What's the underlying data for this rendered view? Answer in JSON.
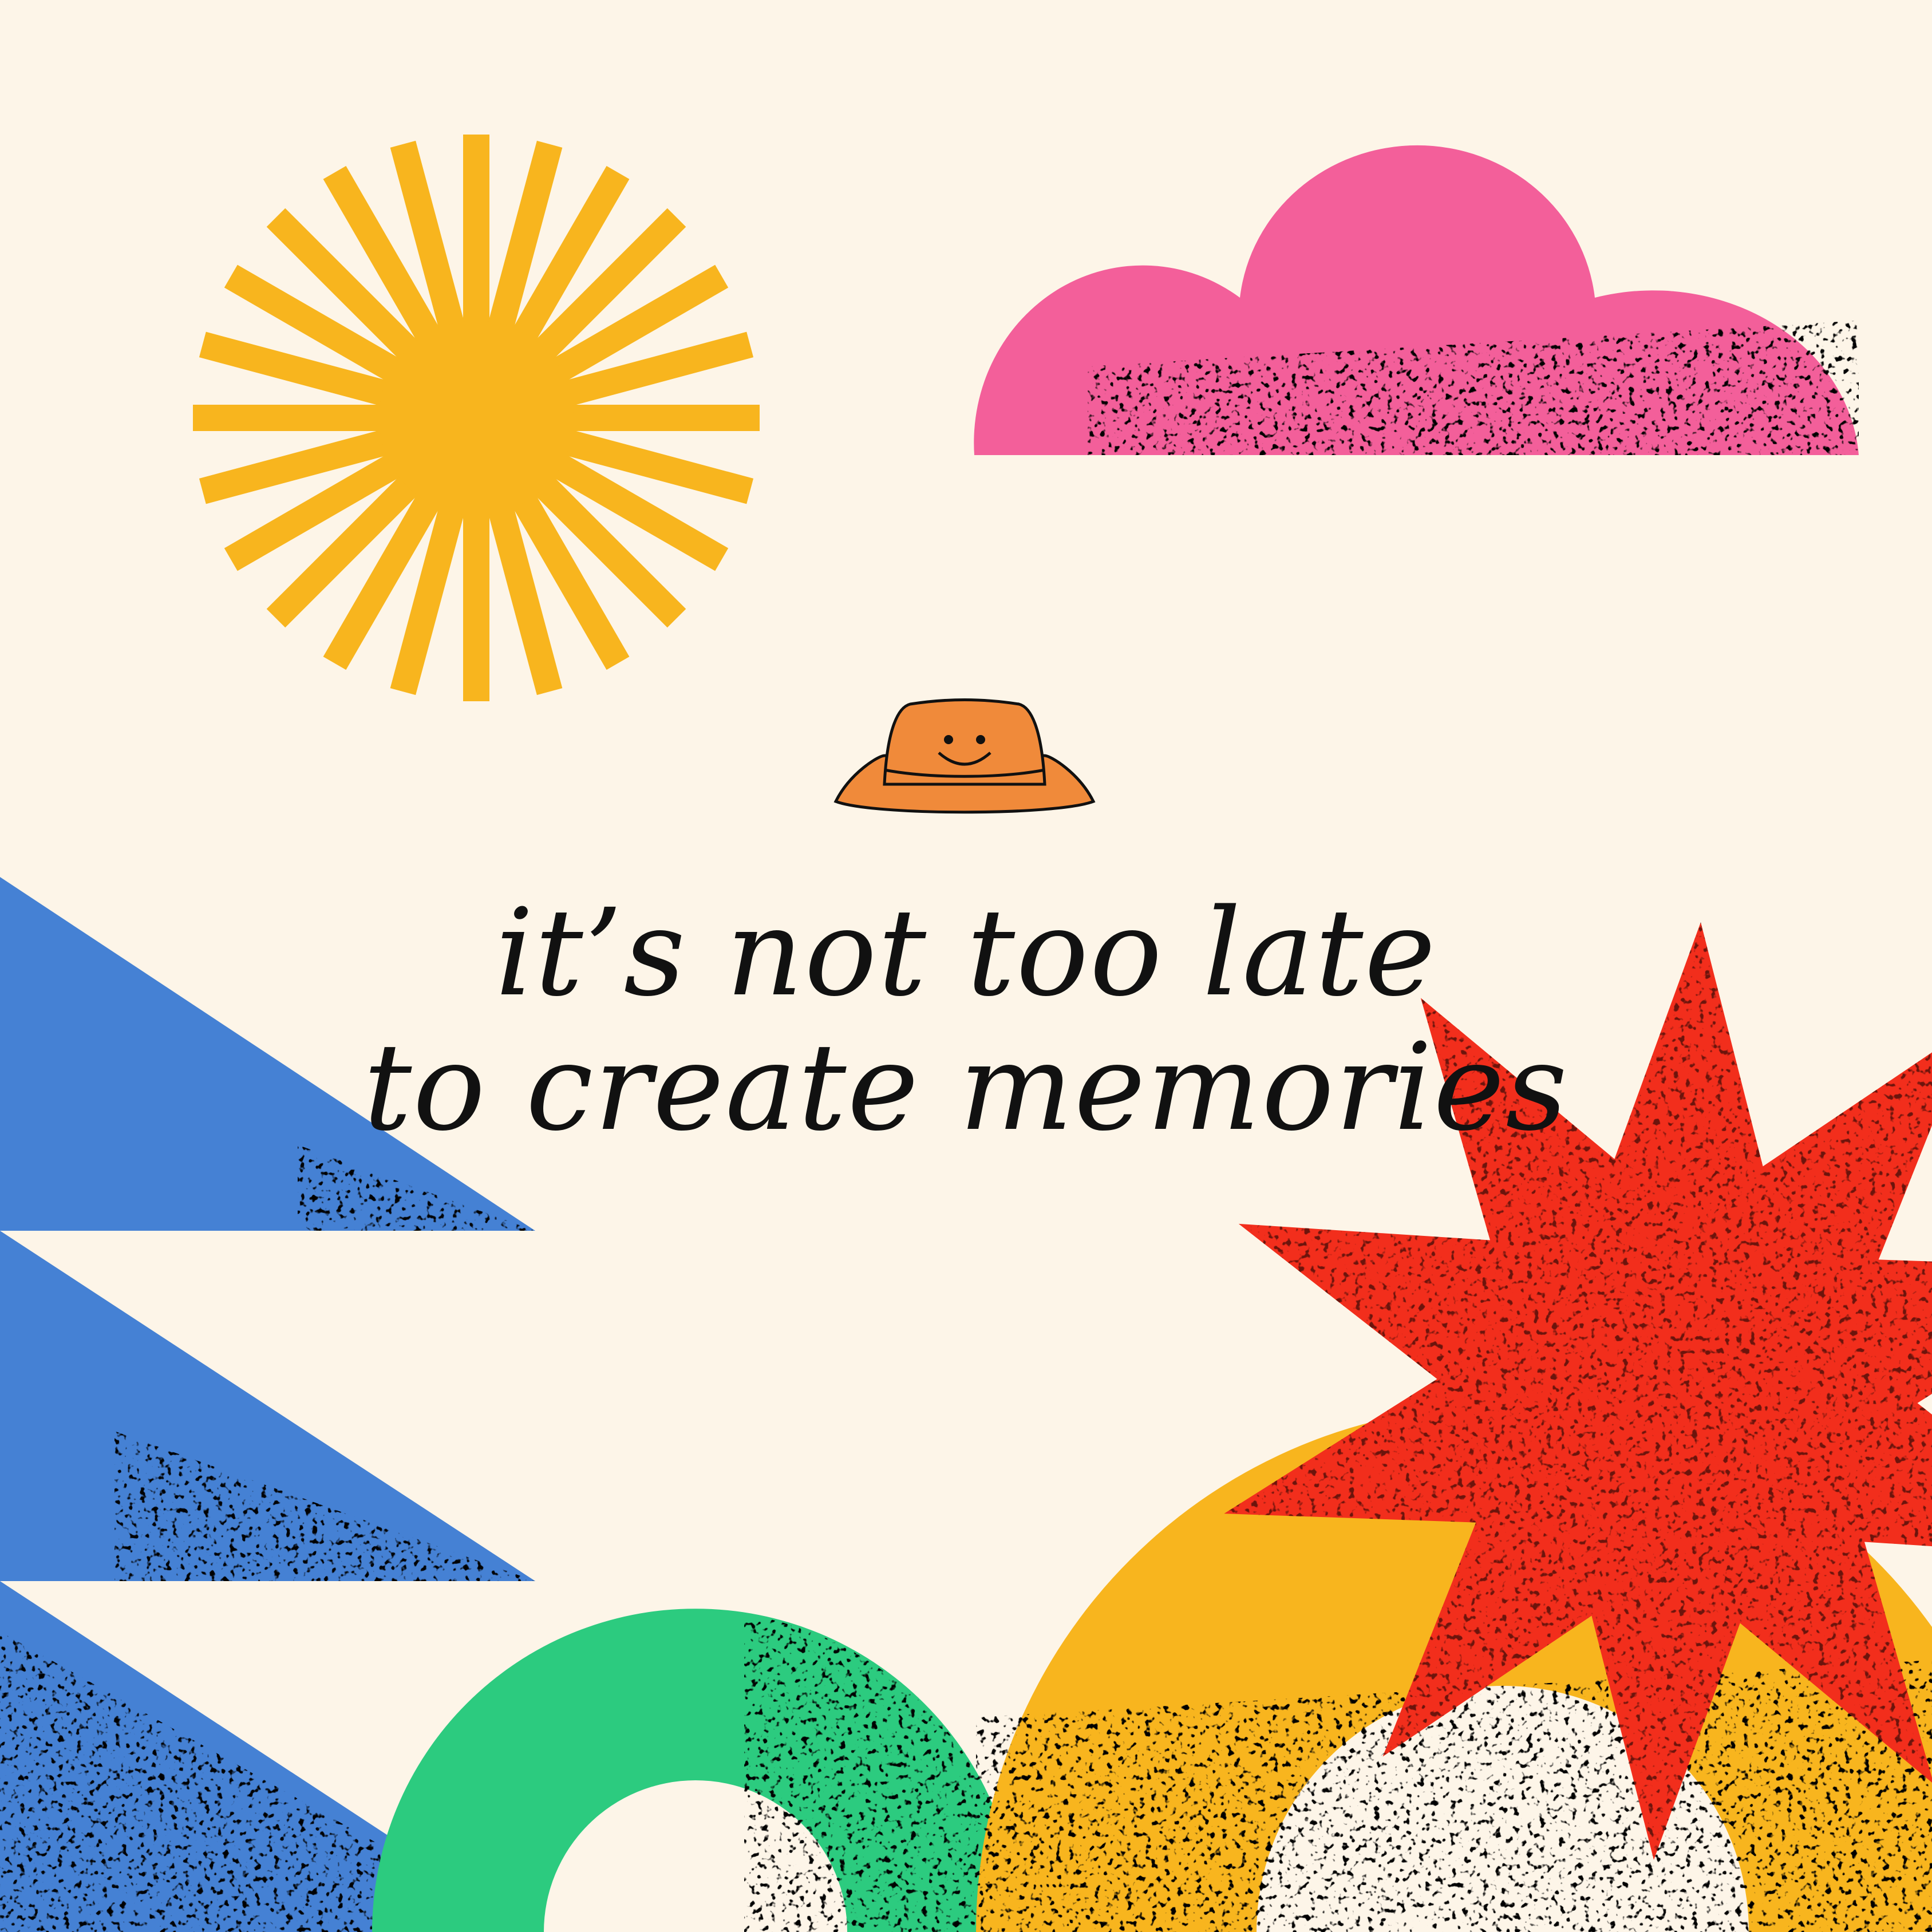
{
  "headline": {
    "line1": "it’s not too late",
    "line2": "to create memories"
  },
  "colors": {
    "background": "#FDF5E8",
    "sun": "#F8B51E",
    "sun_speckle": "#E0621A",
    "cloud": "#F35F9A",
    "cloud_speckle": "#A8207A",
    "triangles": "#4581D4",
    "triangles_speckle": "#23549E",
    "green_arch": "#2CCB7F",
    "green_speckle": "#1E9A5A",
    "yellow_arch": "#F8B51E",
    "yellow_speckle": "#E0621A",
    "starburst": "#F22E1C",
    "starburst_speckle": "#FBD8D0",
    "hat": "#F08A3A",
    "outline": "#111111"
  },
  "icons": {
    "sun": "sun-icon",
    "cloud": "cloud-icon",
    "hat": "bucket-hat-icon",
    "starburst": "starburst-icon"
  }
}
